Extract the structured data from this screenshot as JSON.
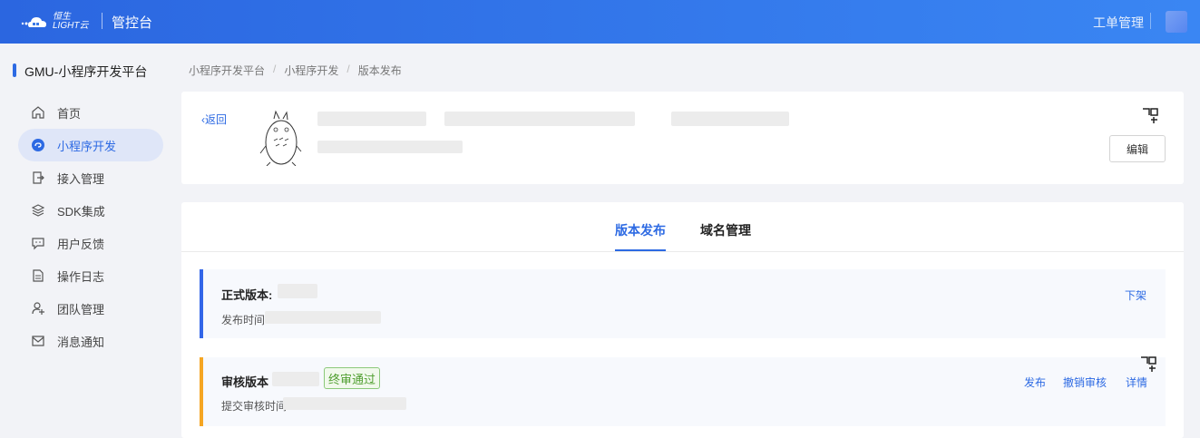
{
  "header": {
    "logo_text_top": "恒生",
    "logo_text_bottom": "LIGHT云",
    "console_title": "管控台",
    "ticket_link": "工单管理"
  },
  "sidebar": {
    "platform_title": "GMU-小程序开发平台",
    "items": [
      {
        "label": "首页",
        "icon": "home-icon"
      },
      {
        "label": "小程序开发",
        "icon": "miniapp-icon",
        "active": true
      },
      {
        "label": "接入管理",
        "icon": "access-icon"
      },
      {
        "label": "SDK集成",
        "icon": "layers-icon"
      },
      {
        "label": "用户反馈",
        "icon": "feedback-icon"
      },
      {
        "label": "操作日志",
        "icon": "log-icon"
      },
      {
        "label": "团队管理",
        "icon": "team-icon"
      },
      {
        "label": "消息通知",
        "icon": "mail-icon"
      }
    ]
  },
  "breadcrumb": [
    "小程序开发平台",
    "小程序开发",
    "版本发布"
  ],
  "app_card": {
    "back_label": "返回",
    "edit_label": "编辑"
  },
  "tabs": [
    "版本发布",
    "域名管理"
  ],
  "versions": {
    "release": {
      "title": "正式版本:",
      "time_label": "发布时间",
      "action": "下架"
    },
    "review": {
      "title": "审核版本",
      "status": "终审通过",
      "time_label": "提交审核时间",
      "actions": [
        "发布",
        "撤销审核",
        "详情"
      ]
    }
  },
  "colors": {
    "accent": "#2d6ae3",
    "release_bar": "#3366e8",
    "review_bar": "#f5a623",
    "status_green": "#4f9e2f"
  }
}
